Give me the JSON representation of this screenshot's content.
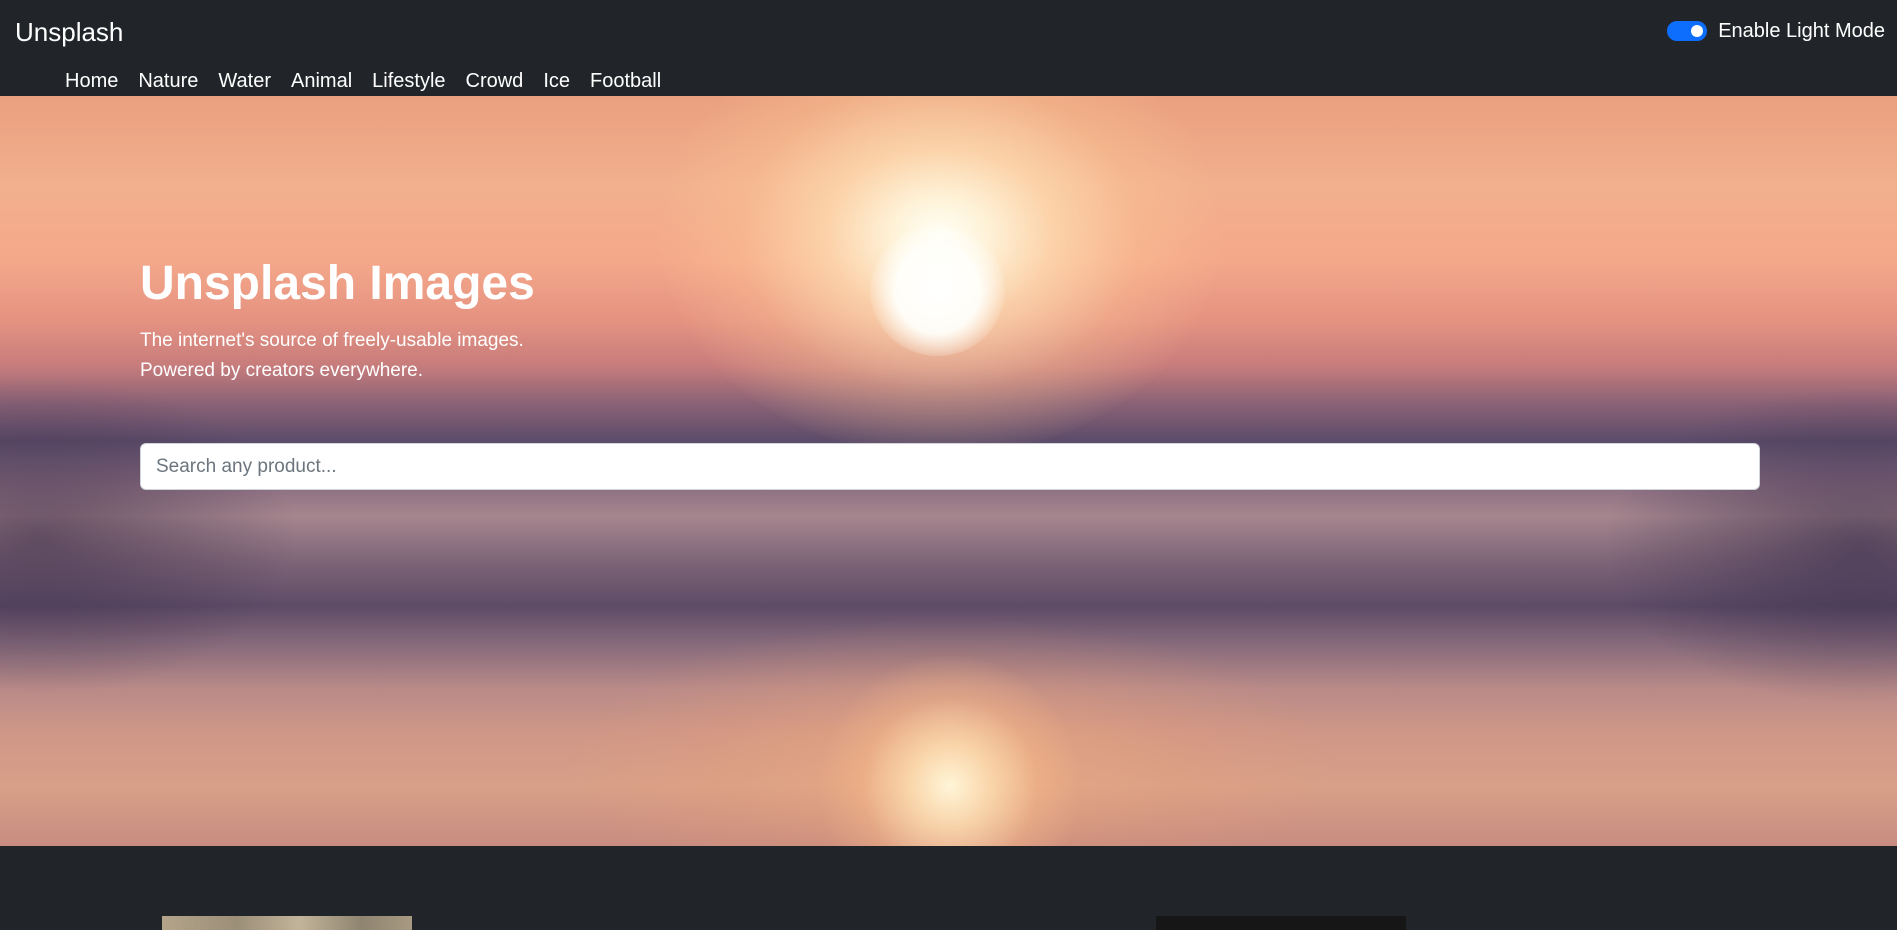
{
  "navbar": {
    "brand": "Unsplash",
    "links": [
      "Home",
      "Nature",
      "Water",
      "Animal",
      "Lifestyle",
      "Crowd",
      "Ice",
      "Football"
    ],
    "mode_toggle": {
      "label": "Enable Light Mode",
      "checked": true
    }
  },
  "hero": {
    "title": "Unsplash Images",
    "subtitle_line1": "The internet's source of freely-usable images.",
    "subtitle_line2": "Powered by creators everywhere.",
    "search": {
      "placeholder": "Search any product...",
      "value": ""
    }
  },
  "theme": {
    "background": "#212529",
    "accent": "#0d6efd",
    "text": "#ffffff"
  }
}
